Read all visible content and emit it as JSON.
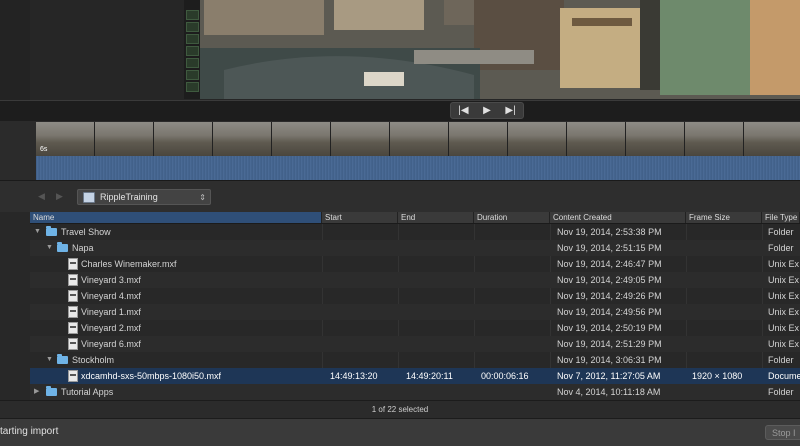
{
  "filmstrip": {
    "duration_label": "6s"
  },
  "transport": {
    "prev_icon": "skip-back-icon",
    "play_icon": "play-icon",
    "next_icon": "skip-forward-icon",
    "prev_glyph": "|◀",
    "play_glyph": "▶",
    "next_glyph": "▶|"
  },
  "toolbar": {
    "back_glyph": "◀",
    "forward_glyph": "▶",
    "library": "RippleTraining",
    "library_chevron": "⇕"
  },
  "list": {
    "columns": [
      "Name",
      "Start",
      "End",
      "Duration",
      "Content Created",
      "Frame Size",
      "File Type"
    ],
    "rows": [
      {
        "name": "Travel Show",
        "type_icon": "folder-icon",
        "disclosure": "▼",
        "start": "",
        "end": "",
        "duration": "",
        "created": "Nov 19, 2014, 2:53:38 PM",
        "frame_size": "",
        "file_type": "Folder"
      },
      {
        "name": "Napa",
        "type_icon": "folder-icon",
        "disclosure": "▼",
        "start": "",
        "end": "",
        "duration": "",
        "created": "Nov 19, 2014, 2:51:15 PM",
        "frame_size": "",
        "file_type": "Folder"
      },
      {
        "name": "Charles Winemaker.mxf",
        "type_icon": "file-icon",
        "disclosure": "",
        "start": "",
        "end": "",
        "duration": "",
        "created": "Nov 19, 2014, 2:46:47 PM",
        "frame_size": "",
        "file_type": "Unix Ex"
      },
      {
        "name": "Vineyard 3.mxf",
        "type_icon": "file-icon",
        "disclosure": "",
        "start": "",
        "end": "",
        "duration": "",
        "created": "Nov 19, 2014, 2:49:05 PM",
        "frame_size": "",
        "file_type": "Unix Ex"
      },
      {
        "name": "Vineyard 4.mxf",
        "type_icon": "file-icon",
        "disclosure": "",
        "start": "",
        "end": "",
        "duration": "",
        "created": "Nov 19, 2014, 2:49:26 PM",
        "frame_size": "",
        "file_type": "Unix Ex"
      },
      {
        "name": "Vineyard 1.mxf",
        "type_icon": "file-icon",
        "disclosure": "",
        "start": "",
        "end": "",
        "duration": "",
        "created": "Nov 19, 2014, 2:49:56 PM",
        "frame_size": "",
        "file_type": "Unix Ex"
      },
      {
        "name": "Vineyard 2.mxf",
        "type_icon": "file-icon",
        "disclosure": "",
        "start": "",
        "end": "",
        "duration": "",
        "created": "Nov 19, 2014, 2:50:19 PM",
        "frame_size": "",
        "file_type": "Unix Ex"
      },
      {
        "name": "Vineyard 6.mxf",
        "type_icon": "file-icon",
        "disclosure": "",
        "start": "",
        "end": "",
        "duration": "",
        "created": "Nov 19, 2014, 2:51:29 PM",
        "frame_size": "",
        "file_type": "Unix Ex"
      },
      {
        "name": "Stockholm",
        "type_icon": "folder-icon",
        "disclosure": "▼",
        "start": "",
        "end": "",
        "duration": "",
        "created": "Nov 19, 2014, 3:06:31 PM",
        "frame_size": "",
        "file_type": "Folder"
      },
      {
        "name": "xdcamhd-sxs-50mbps-1080i50.mxf",
        "type_icon": "file-icon",
        "disclosure": "",
        "start": "14:49:13:20",
        "end": "14:49:20:11",
        "duration": "00:00:06:16",
        "created": "Nov 7, 2012, 11:27:05 AM",
        "frame_size": "1920 × 1080",
        "file_type": "Docume",
        "selected": true
      },
      {
        "name": "Tutorial Apps",
        "type_icon": "folder-icon",
        "disclosure": "▶",
        "start": "",
        "end": "",
        "duration": "",
        "created": "Nov 4, 2014, 10:11:18 AM",
        "frame_size": "",
        "file_type": "Folder"
      }
    ]
  },
  "status": {
    "selection": "1 of 22 selected",
    "import": "tarting import",
    "stop_label": "Stop I"
  },
  "colors": {
    "selection": "#1e3656",
    "folder": "#6fb3e6",
    "waveform": "#3f5e86"
  }
}
